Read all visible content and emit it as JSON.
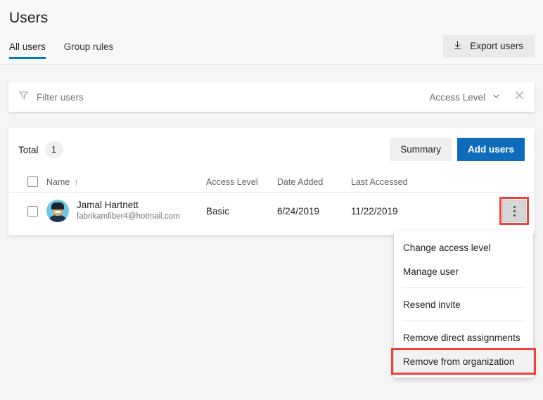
{
  "header": {
    "title": "Users",
    "tabs": [
      {
        "label": "All users",
        "active": true
      },
      {
        "label": "Group rules",
        "active": false
      }
    ],
    "export_button": {
      "label": "Export users",
      "icon": "download-icon"
    }
  },
  "filter_bar": {
    "filter_icon": "funnel-icon",
    "input_value": "",
    "placeholder": "Filter users",
    "access_level": {
      "label": "Access Level",
      "chevron_icon": "chevron-down-icon"
    },
    "clear_icon": "close-icon"
  },
  "table": {
    "total_label": "Total",
    "total_count": "1",
    "buttons": {
      "summary": "Summary",
      "add_users": "Add users"
    },
    "columns": {
      "name": "Name",
      "name_sort_indicator": "↑",
      "access_level": "Access Level",
      "date_added": "Date Added",
      "last_accessed": "Last Accessed"
    },
    "rows": [
      {
        "name": "Jamal Hartnett",
        "email": "fabrikamfiber4@hotmail.com",
        "access_level": "Basic",
        "date_added": "6/24/2019",
        "last_accessed": "11/22/2019",
        "avatar": "user-avatar",
        "more_actions_icon": "ellipsis-vertical-icon"
      }
    ]
  },
  "context_menu": {
    "items": [
      {
        "label": "Change access level",
        "highlighted": false
      },
      {
        "label": "Manage user",
        "highlighted": false
      },
      {
        "label": "Resend invite",
        "highlighted": false
      },
      {
        "label": "Remove direct assignments",
        "highlighted": false
      },
      {
        "label": "Remove from organization",
        "highlighted": true
      }
    ]
  },
  "colors": {
    "accent_blue": "#0f6cbd",
    "tab_underline": "#0078d4",
    "highlight_red": "#f04037",
    "page_background": "#f5f5f5"
  }
}
